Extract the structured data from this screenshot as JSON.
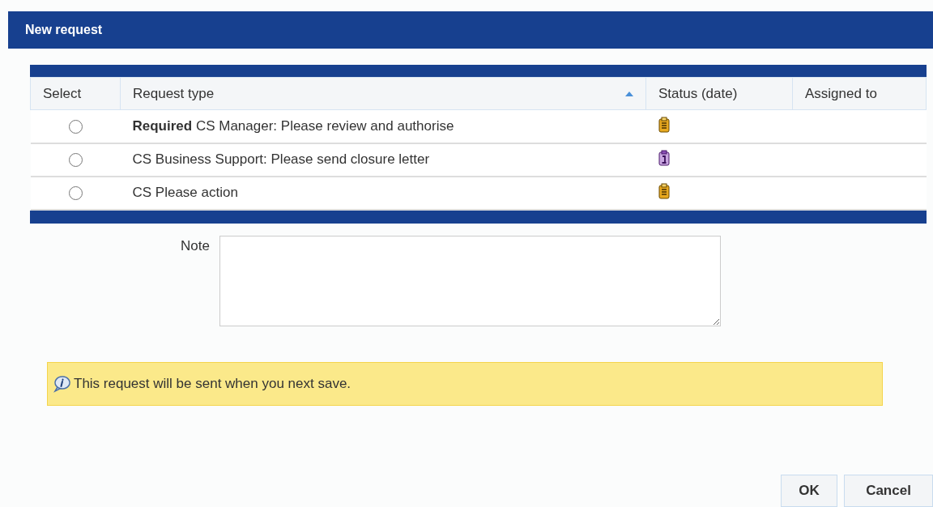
{
  "dialog": {
    "title": "New request"
  },
  "table": {
    "columns": [
      {
        "label": "Select",
        "sorted": false
      },
      {
        "label": "Request type",
        "sorted": true
      },
      {
        "label": "Status (date)",
        "sorted": false
      },
      {
        "label": "Assigned to",
        "sorted": false
      }
    ],
    "rows": [
      {
        "selected": false,
        "request_type": "**Required** CS Manager: Please review and authorise",
        "status": {
          "kind": "clipboard"
        }
      },
      {
        "selected": false,
        "request_type": "CS Business Support: Please send closure letter",
        "status": {
          "kind": "info"
        }
      },
      {
        "selected": false,
        "request_type": "CS Please action",
        "status": {
          "kind": "clipboard"
        }
      }
    ]
  },
  "note": {
    "label": "Note"
  },
  "info_message": "This request will be sent when you next save.",
  "buttons": [
    "OK",
    "Cancel"
  ]
}
